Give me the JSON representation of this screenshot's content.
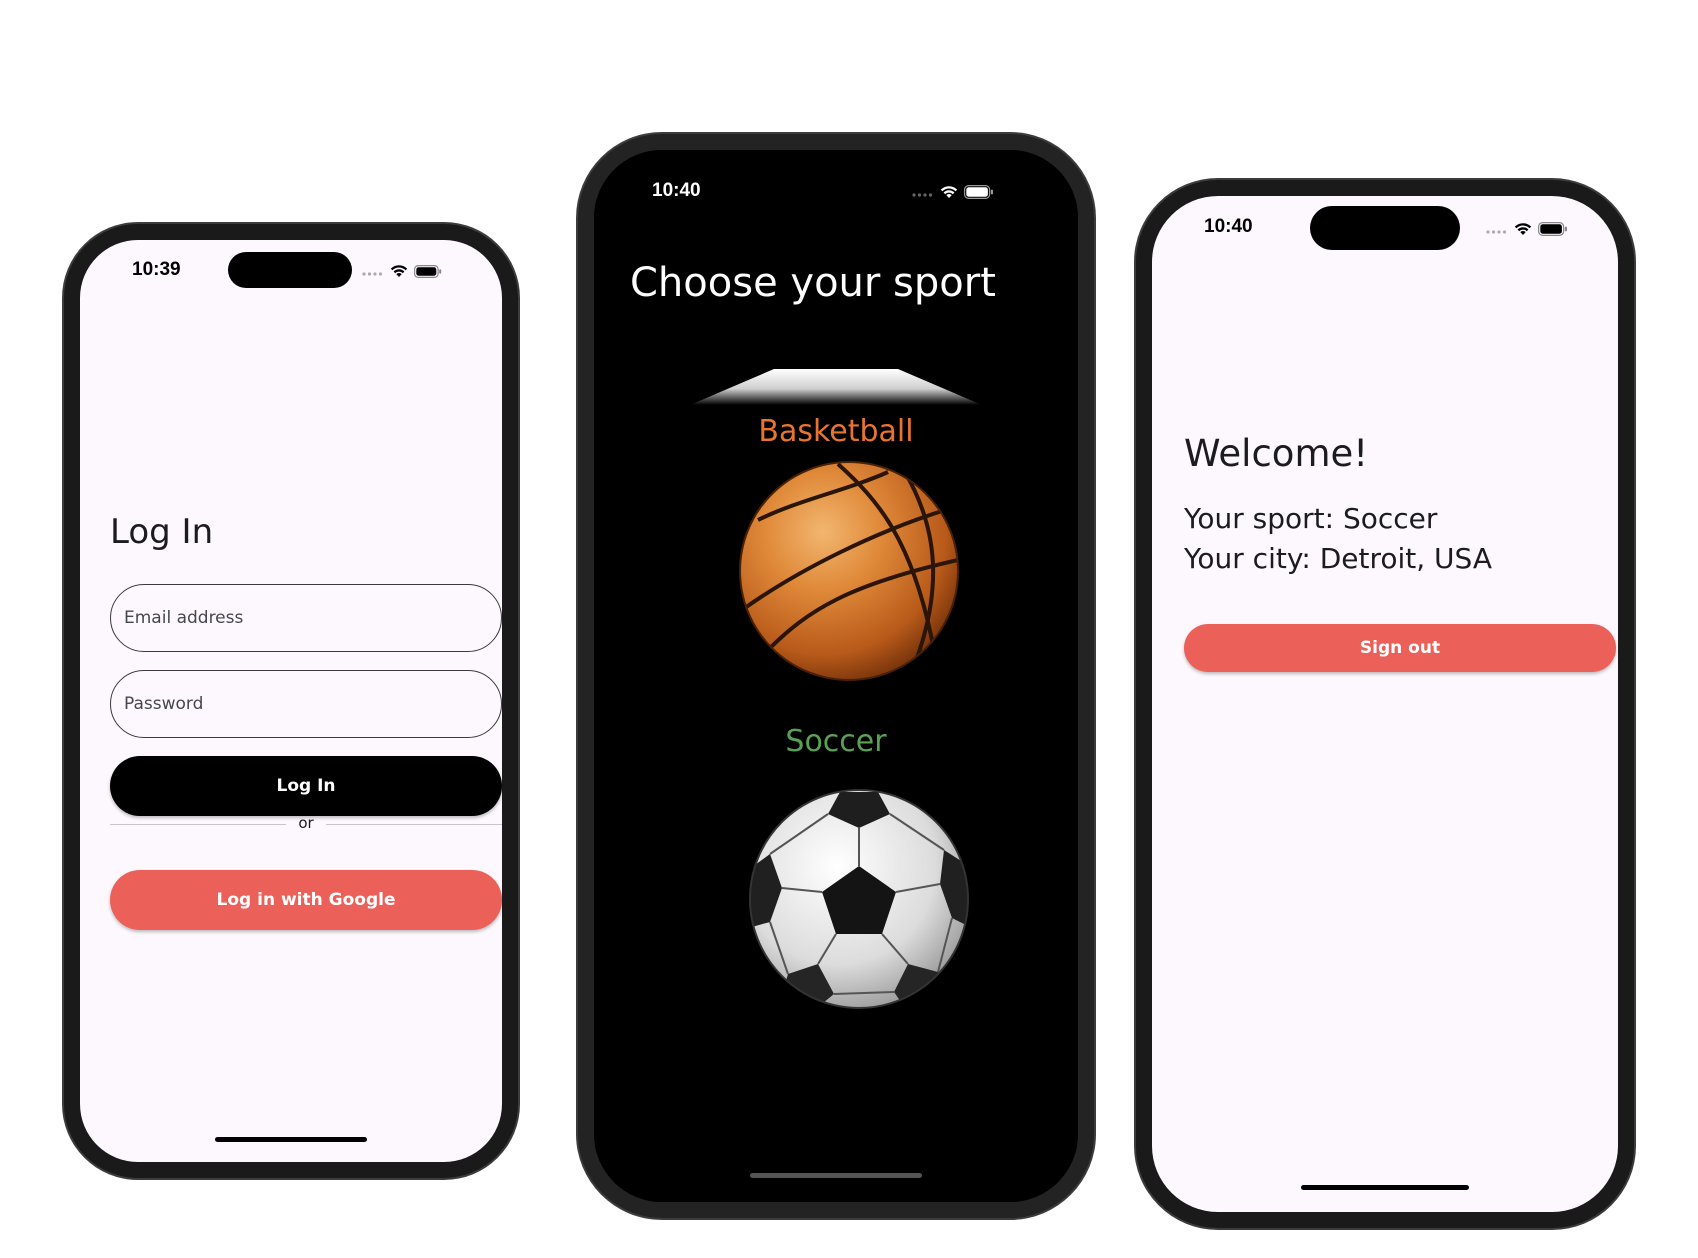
{
  "login_screen": {
    "status_time": "10:39",
    "title": "Log In",
    "email_placeholder": "Email address",
    "password_placeholder": "Password",
    "login_button_label": "Log In",
    "divider_text": "or",
    "google_button_label": "Log in with Google",
    "accent_color": "#ec605a"
  },
  "sport_screen": {
    "status_time": "10:40",
    "title": "Choose your sport",
    "sports": [
      {
        "label": "Basketball",
        "color": "#e9742f",
        "icon": "basketball-icon"
      },
      {
        "label": "Soccer",
        "color": "#5aa156",
        "icon": "soccer-ball-icon"
      }
    ]
  },
  "welcome_screen": {
    "status_time": "10:40",
    "title": "Welcome!",
    "sport_line": "Your sport: Soccer",
    "city_line": "Your city: Detroit, USA",
    "signout_button_label": "Sign out",
    "accent_color": "#ec605a"
  },
  "status_icons": [
    "signal-dots-icon",
    "wifi-icon",
    "battery-icon"
  ]
}
